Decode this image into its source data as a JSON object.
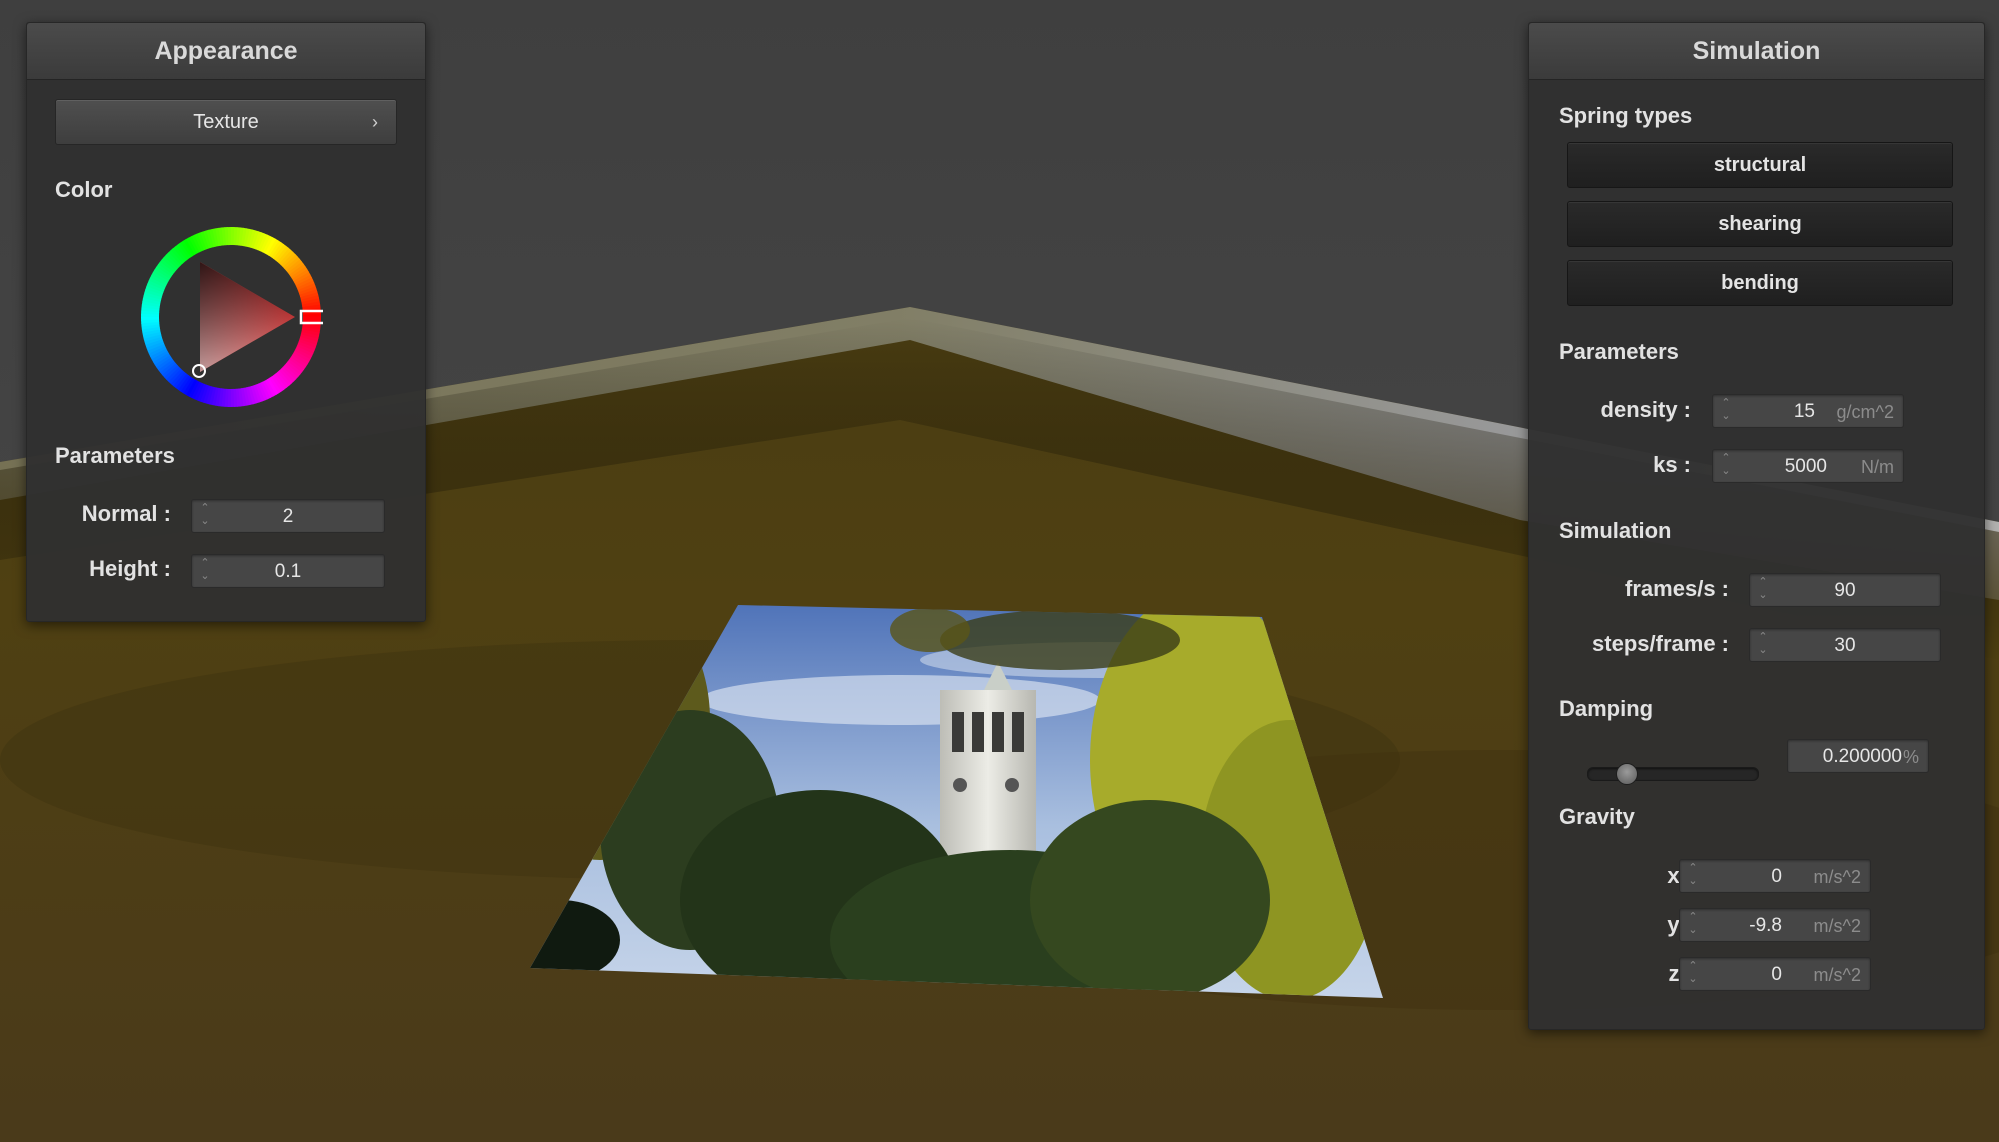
{
  "appearance": {
    "title": "Appearance",
    "texture_button": "Texture",
    "texture_chevron": "›",
    "color_label": "Color",
    "selected_color": "#e01010",
    "parameters_label": "Parameters",
    "normal_label": "Normal :",
    "normal_value": "2",
    "height_label": "Height :",
    "height_value": "0.1"
  },
  "simulation": {
    "title": "Simulation",
    "spring_types_label": "Spring types",
    "spring_types": [
      "structural",
      "shearing",
      "bending"
    ],
    "parameters_label": "Parameters",
    "density_label": "density :",
    "density_value": "15",
    "density_unit": "g/cm^2",
    "ks_label": "ks :",
    "ks_value": "5000",
    "ks_unit": "N/m",
    "simulation_label": "Simulation",
    "fps_label": "frames/s :",
    "fps_value": "90",
    "steps_label": "steps/frame :",
    "steps_value": "30",
    "damping_label": "Damping",
    "damping_value": "0.200000",
    "damping_unit": "%",
    "damping_fraction": 0.2,
    "gravity_label": "Gravity",
    "gx_label": "x :",
    "gx_value": "0",
    "gx_unit": "m/s^2",
    "gy_label": "y :",
    "gy_value": "-9.8",
    "gy_unit": "m/s^2",
    "gz_label": "z :",
    "gz_value": "0",
    "gz_unit": "m/s^2"
  },
  "icons": {
    "spinner": "spinner-icon",
    "chevron": "chevron-right-icon"
  },
  "colors": {
    "background": "#3e3e3e",
    "floor": "#4d3e14",
    "panel": "#303030"
  }
}
